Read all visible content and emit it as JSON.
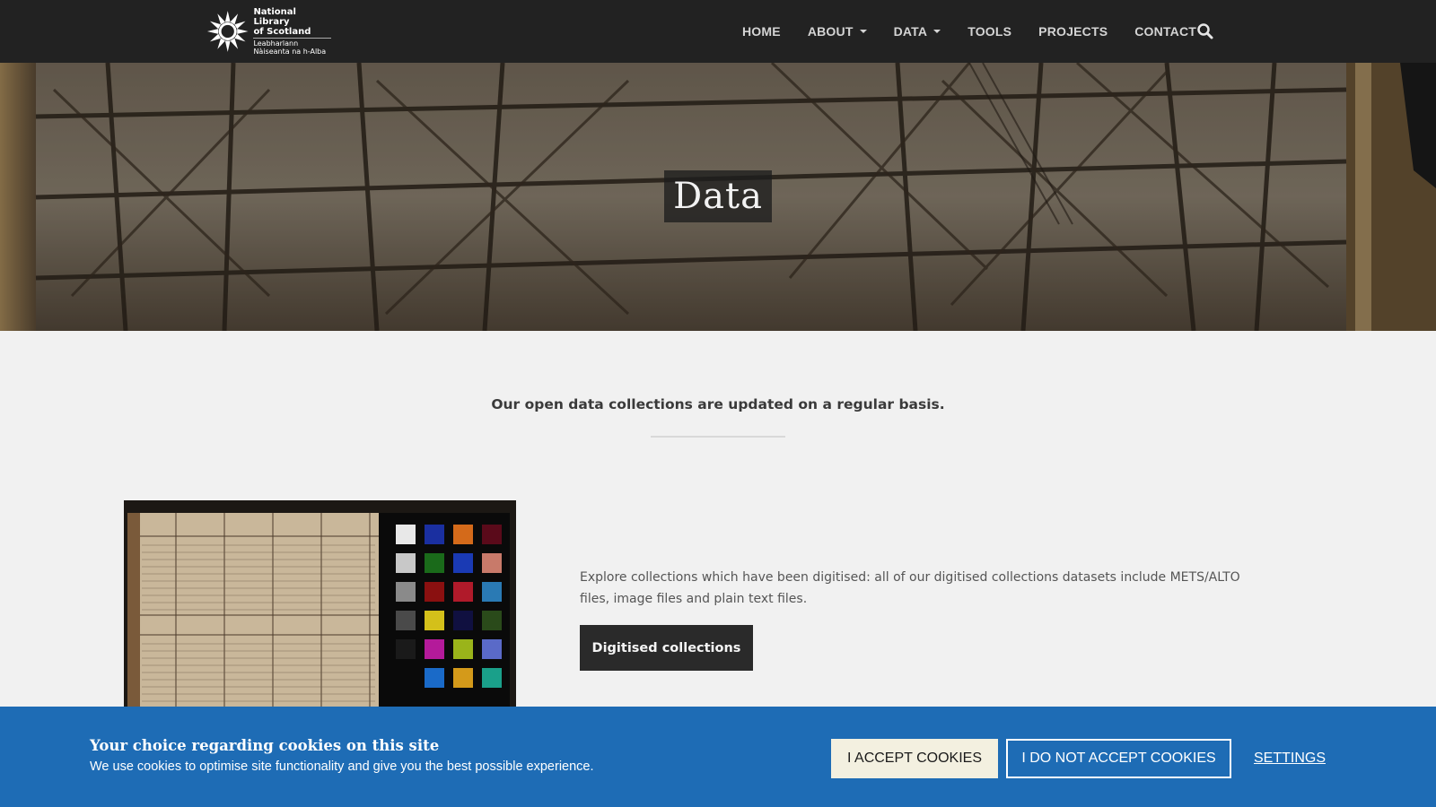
{
  "logo": {
    "line1": "National Library",
    "line2": "of Scotland",
    "line3": "Leabharlann",
    "line4": "Nàiseanta na h-Alba"
  },
  "nav": {
    "items": [
      {
        "label": "HOME",
        "dropdown": false
      },
      {
        "label": "ABOUT",
        "dropdown": true
      },
      {
        "label": "DATA",
        "dropdown": true
      },
      {
        "label": "TOOLS",
        "dropdown": false
      },
      {
        "label": "PROJECTS",
        "dropdown": false
      },
      {
        "label": "CONTACT",
        "dropdown": false
      }
    ],
    "search_icon": "search-icon"
  },
  "hero": {
    "title": "Data"
  },
  "content": {
    "intro": "Our open data collections are updated on a regular basis.",
    "description": "Explore collections which have been digitised: all of our digitised collections datasets include METS/ALTO files, image files and plain text files.",
    "cta_label": "Digitised collections"
  },
  "cookie": {
    "title": "Your choice regarding cookies on this site",
    "text": "We use cookies to optimise site functionality and give you the best possible experience.",
    "accept_label": "I ACCEPT COOKIES",
    "decline_label": "I DO NOT ACCEPT COOKIES",
    "settings_label": "SETTINGS"
  },
  "colors": {
    "nav_bg": "#222222",
    "cookie_bg": "#1e6cb5",
    "accept_bg": "#f3f0e0",
    "cta_bg": "#2a2a2a"
  }
}
